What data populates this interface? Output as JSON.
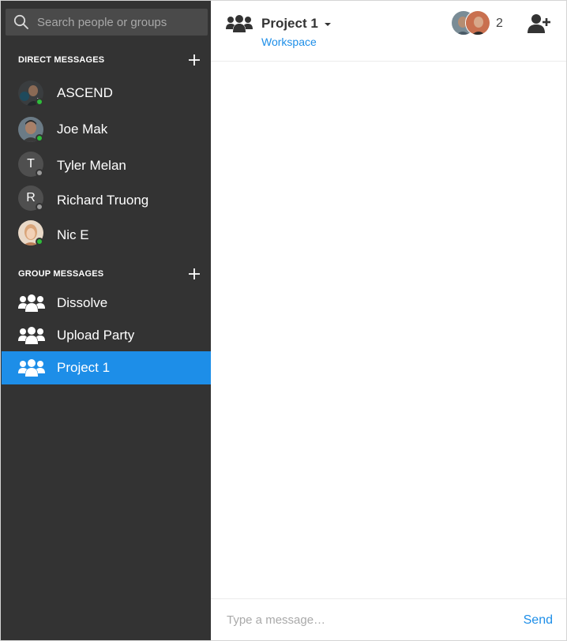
{
  "search": {
    "placeholder": "Search people or groups",
    "icon": "search-icon"
  },
  "direct_messages": {
    "title": "DIRECT MESSAGES",
    "add_icon": "plus-icon",
    "items": [
      {
        "name": "ASCEND",
        "avatar": "photo",
        "status": "online"
      },
      {
        "name": "Joe Mak",
        "avatar": "photo",
        "status": "online"
      },
      {
        "name": "Tyler Melan",
        "avatar": "T",
        "status": "offline"
      },
      {
        "name": "Richard Truong",
        "avatar": "R",
        "status": "offline"
      },
      {
        "name": "Nic E",
        "avatar": "photo",
        "status": "online"
      }
    ]
  },
  "group_messages": {
    "title": "GROUP MESSAGES",
    "add_icon": "plus-icon",
    "items": [
      {
        "name": "Dissolve",
        "icon": "group-icon",
        "active": false
      },
      {
        "name": "Upload Party",
        "icon": "group-icon",
        "active": false
      },
      {
        "name": "Project 1",
        "icon": "group-icon",
        "active": true
      }
    ]
  },
  "header": {
    "title": "Project 1",
    "subtitle": "Workspace",
    "member_count": "2",
    "icons": [
      "group-icon",
      "caret-down-icon",
      "add-user-icon"
    ]
  },
  "composer": {
    "placeholder": "Type a message…",
    "send_label": "Send"
  },
  "colors": {
    "sidebar_bg": "#333333",
    "accent": "#1d8ee8",
    "online": "#2ebd3b",
    "offline": "#9a9a9a"
  }
}
